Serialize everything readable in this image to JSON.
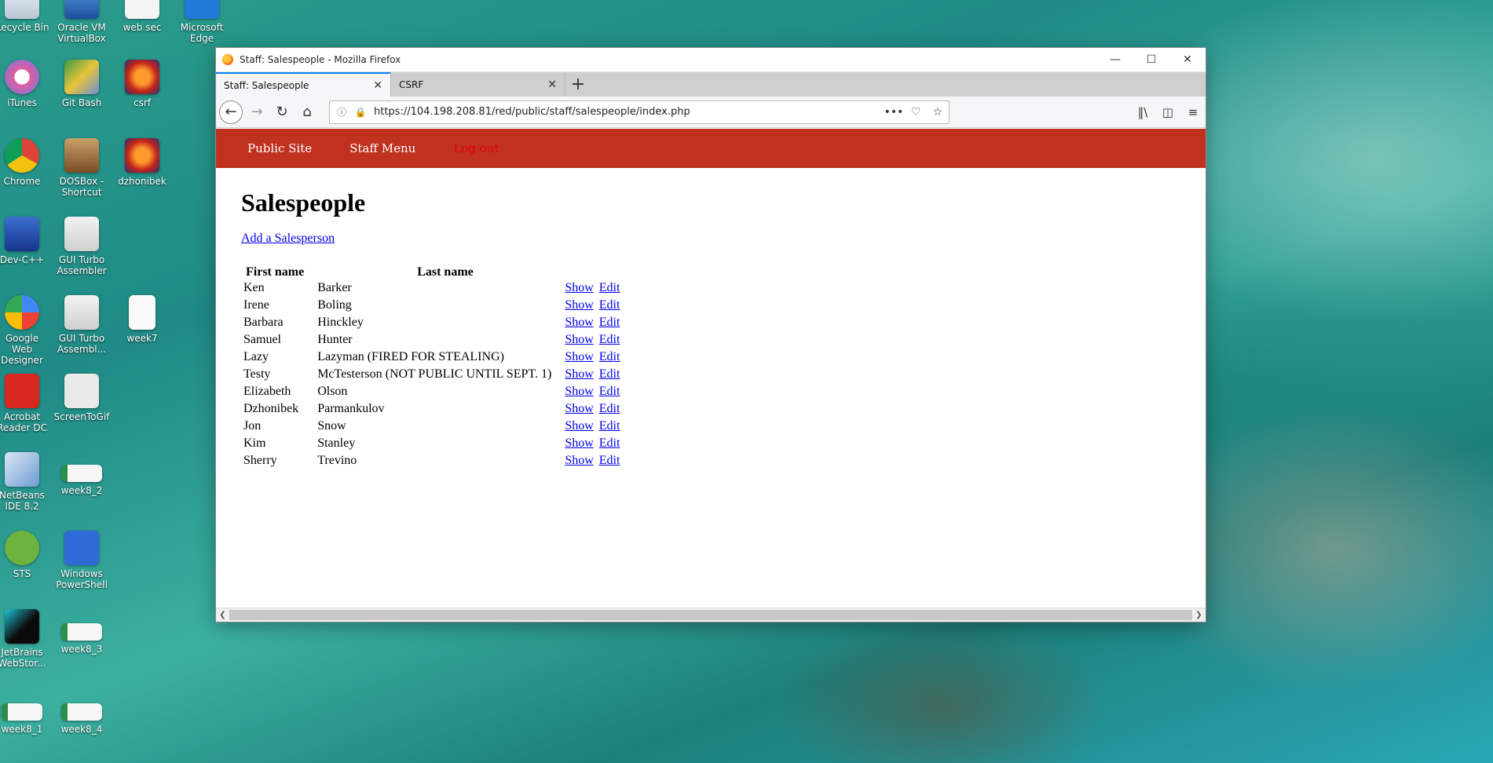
{
  "desktop": {
    "icons": [
      {
        "label": "Recycle Bin"
      },
      {
        "label": "Oracle VM VirtualBox"
      },
      {
        "label": "web sec"
      },
      {
        "label": "Microsoft Edge"
      },
      {
        "label": "iTunes"
      },
      {
        "label": "Git Bash"
      },
      {
        "label": "csrf"
      },
      {
        "label": "Chrome"
      },
      {
        "label": "DOSBox - Shortcut"
      },
      {
        "label": "dzhonibek"
      },
      {
        "label": "Dev-C++"
      },
      {
        "label": "GUI Turbo Assembler"
      },
      {
        "label": "Google Web Designer"
      },
      {
        "label": "GUI Turbo Assembl..."
      },
      {
        "label": "week7"
      },
      {
        "label": "Acrobat Reader DC"
      },
      {
        "label": "ScreenToGif"
      },
      {
        "label": "NetBeans IDE 8.2"
      },
      {
        "label": "week8_2"
      },
      {
        "label": "STS"
      },
      {
        "label": "Windows PowerShell"
      },
      {
        "label": "JetBrains WebStor..."
      },
      {
        "label": "week8_3"
      },
      {
        "label": "week8_1"
      },
      {
        "label": "week8_4"
      }
    ]
  },
  "window": {
    "title": "Staff: Salespeople - Mozilla Firefox",
    "tabs": [
      {
        "label": "Staff: Salespeople"
      },
      {
        "label": "CSRF"
      }
    ],
    "url": "https://104.198.208.81/red/public/staff/salespeople/index.php"
  },
  "site_nav": {
    "public_site": "Public Site",
    "staff_menu": "Staff Menu",
    "log_out": "Log out"
  },
  "page": {
    "title": "Salespeople",
    "add_link": "Add a Salesperson",
    "columns": {
      "first": "First name",
      "last": "Last name"
    },
    "show_label": "Show",
    "edit_label": "Edit",
    "rows": [
      {
        "first": "Ken",
        "last": "Barker"
      },
      {
        "first": "Irene",
        "last": "Boling"
      },
      {
        "first": "Barbara",
        "last": "Hinckley"
      },
      {
        "first": "Samuel",
        "last": "Hunter"
      },
      {
        "first": "Lazy",
        "last": "Lazyman (FIRED FOR STEALING)"
      },
      {
        "first": "Testy",
        "last": "McTesterson (NOT PUBLIC UNTIL SEPT. 1)"
      },
      {
        "first": "Elizabeth",
        "last": "Olson"
      },
      {
        "first": "Dzhonibek",
        "last": "Parmankulov"
      },
      {
        "first": "Jon",
        "last": "Snow"
      },
      {
        "first": "Kim",
        "last": "Stanley"
      },
      {
        "first": "Sherry",
        "last": "Trevino"
      }
    ]
  },
  "colors": {
    "nav_bar": "#c0311f",
    "link": "#0000ee",
    "logout": "#e60000",
    "tab_accent": "#0a84ff"
  }
}
